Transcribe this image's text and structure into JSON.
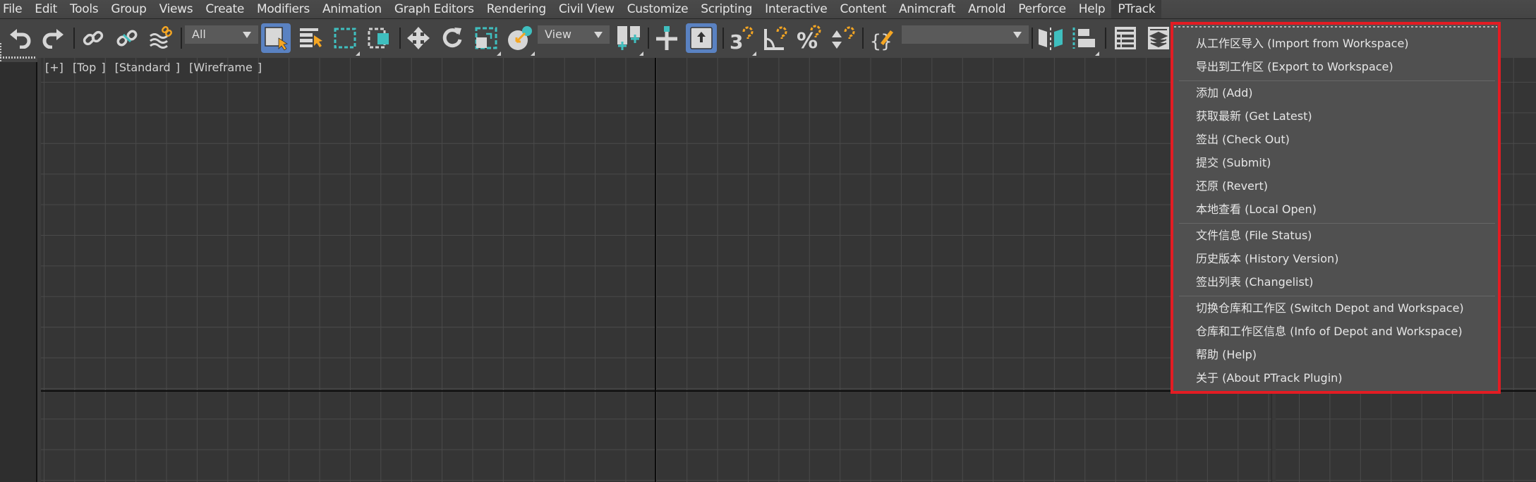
{
  "menubar": {
    "items": [
      "File",
      "Edit",
      "Tools",
      "Group",
      "Views",
      "Create",
      "Modifiers",
      "Animation",
      "Graph Editors",
      "Rendering",
      "Civil View",
      "Customize",
      "Scripting",
      "Interactive",
      "Content",
      "Animcraft",
      "Arnold",
      "Perforce",
      "Help",
      "PTrack"
    ],
    "active": "PTrack"
  },
  "toolbar": {
    "selection_filter": "All",
    "reference_coord": "View",
    "named_selection": "",
    "icons": {
      "undo": "undo-icon",
      "redo": "redo-icon",
      "link": "select-and-link-icon",
      "unlink": "unlink-selection-icon",
      "bind_space_warp": "bind-to-space-warp-icon",
      "select_object": "select-object-icon",
      "select_by_name": "select-by-name-icon",
      "rect_region": "rectangular-selection-region-icon",
      "window_crossing": "window-crossing-icon",
      "move": "select-and-move-icon",
      "rotate": "select-and-rotate-icon",
      "scale": "select-and-scale-icon",
      "place": "select-and-place-icon",
      "pivot": "use-pivot-point-center-icon",
      "manipulate": "select-and-manipulate-icon",
      "keyboard_shortcut": "keyboard-shortcut-override-icon",
      "snaps": "snaps-toggle-icon",
      "angle_snap": "angle-snap-toggle-icon",
      "percent_snap": "percent-snap-toggle-icon",
      "spinner_snap": "spinner-snap-toggle-icon",
      "edit_named_sel": "edit-named-selection-sets-icon",
      "mirror": "mirror-icon",
      "align": "align-icon",
      "scene_explorer": "toggle-scene-explorer-icon",
      "layer_explorer": "toggle-layer-explorer-icon"
    }
  },
  "viewport": {
    "label_parts": [
      "[+]",
      "[Top ]",
      "[Standard ]",
      "[Wireframe ]"
    ]
  },
  "ptrack_menu": {
    "border_color": "#e31c23",
    "groups": [
      [
        "从工作区导入 (Import from Workspace)",
        "导出到工作区 (Export to Workspace)"
      ],
      [
        "添加 (Add)",
        "获取最新 (Get Latest)",
        "签出 (Check Out)",
        "提交 (Submit)",
        "还原 (Revert)",
        "本地查看 (Local Open)"
      ],
      [
        "文件信息 (File Status)",
        "历史版本 (History Version)",
        "签出列表 (Changelist)"
      ],
      [
        "切换仓库和工作区 (Switch Depot and Workspace)",
        "仓库和工作区信息 (Info of Depot and Workspace)",
        "帮助 (Help)",
        "关于 (About PTrack Plugin)"
      ]
    ]
  }
}
